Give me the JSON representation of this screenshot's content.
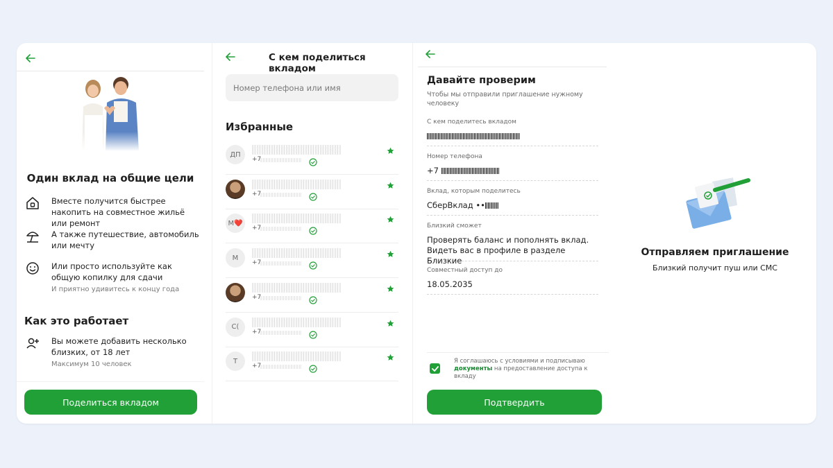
{
  "panel1": {
    "title": "Один вклад на общие цели",
    "features": [
      {
        "icon": "house-icon",
        "text": "Вместе получится быстрее накопить на совместное жильё или ремонт"
      },
      {
        "icon": "beach-umbrella-icon",
        "text": "А также путешествие, автомобиль или мечту"
      },
      {
        "icon": "smile-icon",
        "text": "Или просто используйте как общую копилку для сдачи",
        "hint": "И приятно удивитесь к концу года"
      }
    ],
    "how_title": "Как это работает",
    "how_item": {
      "icon": "add-person-icon",
      "text": "Вы можете добавить несколько близких, от 18 лет",
      "hint": "Максимум 10 человек"
    },
    "button": "Поделиться вкладом"
  },
  "panel2": {
    "title": "С кем поделиться вкладом",
    "search_placeholder": "Номер телефона или имя",
    "favorites_title": "Избранные",
    "contacts": [
      {
        "initials": "ДП",
        "phone_prefix": "+7",
        "photo": false
      },
      {
        "initials": "",
        "phone_prefix": "+7",
        "photo": true
      },
      {
        "initials": "М❤️",
        "phone_prefix": "+7",
        "photo": false
      },
      {
        "initials": "М",
        "phone_prefix": "+7",
        "photo": false
      },
      {
        "initials": "",
        "phone_prefix": "+7",
        "photo": true
      },
      {
        "initials": "С(",
        "phone_prefix": "+7",
        "photo": false
      },
      {
        "initials": "Т",
        "phone_prefix": "+7",
        "photo": false
      }
    ]
  },
  "panel3": {
    "title": "Давайте проверим",
    "subtitle": "Чтобы мы отправили приглашение нужному человеку",
    "fields": [
      {
        "label": "С кем поделитесь вкладом",
        "value": ""
      },
      {
        "label": "Номер телефона",
        "value": "+7"
      },
      {
        "label": "Вклад, которым поделитесь",
        "value": "СберВклад ••"
      },
      {
        "label": "Близкий сможет",
        "value": "Проверять баланс и пополнять вклад. Видеть вас в профиле в разделе Близкие"
      },
      {
        "label": "Совместный доступ до",
        "value": "18.05.2035"
      }
    ],
    "consent_before": "Я соглашаюсь с условиями и подписываю",
    "consent_link": "документы",
    "consent_after": "на предоставление доступа к вкладу",
    "button": "Подтвердить"
  },
  "panel4": {
    "title": "Отправляем приглашение",
    "subtitle": "Близкий получит пуш или СМС"
  },
  "colors": {
    "accent": "#21a038",
    "background": "#edf2fa",
    "card": "#ffffff"
  }
}
